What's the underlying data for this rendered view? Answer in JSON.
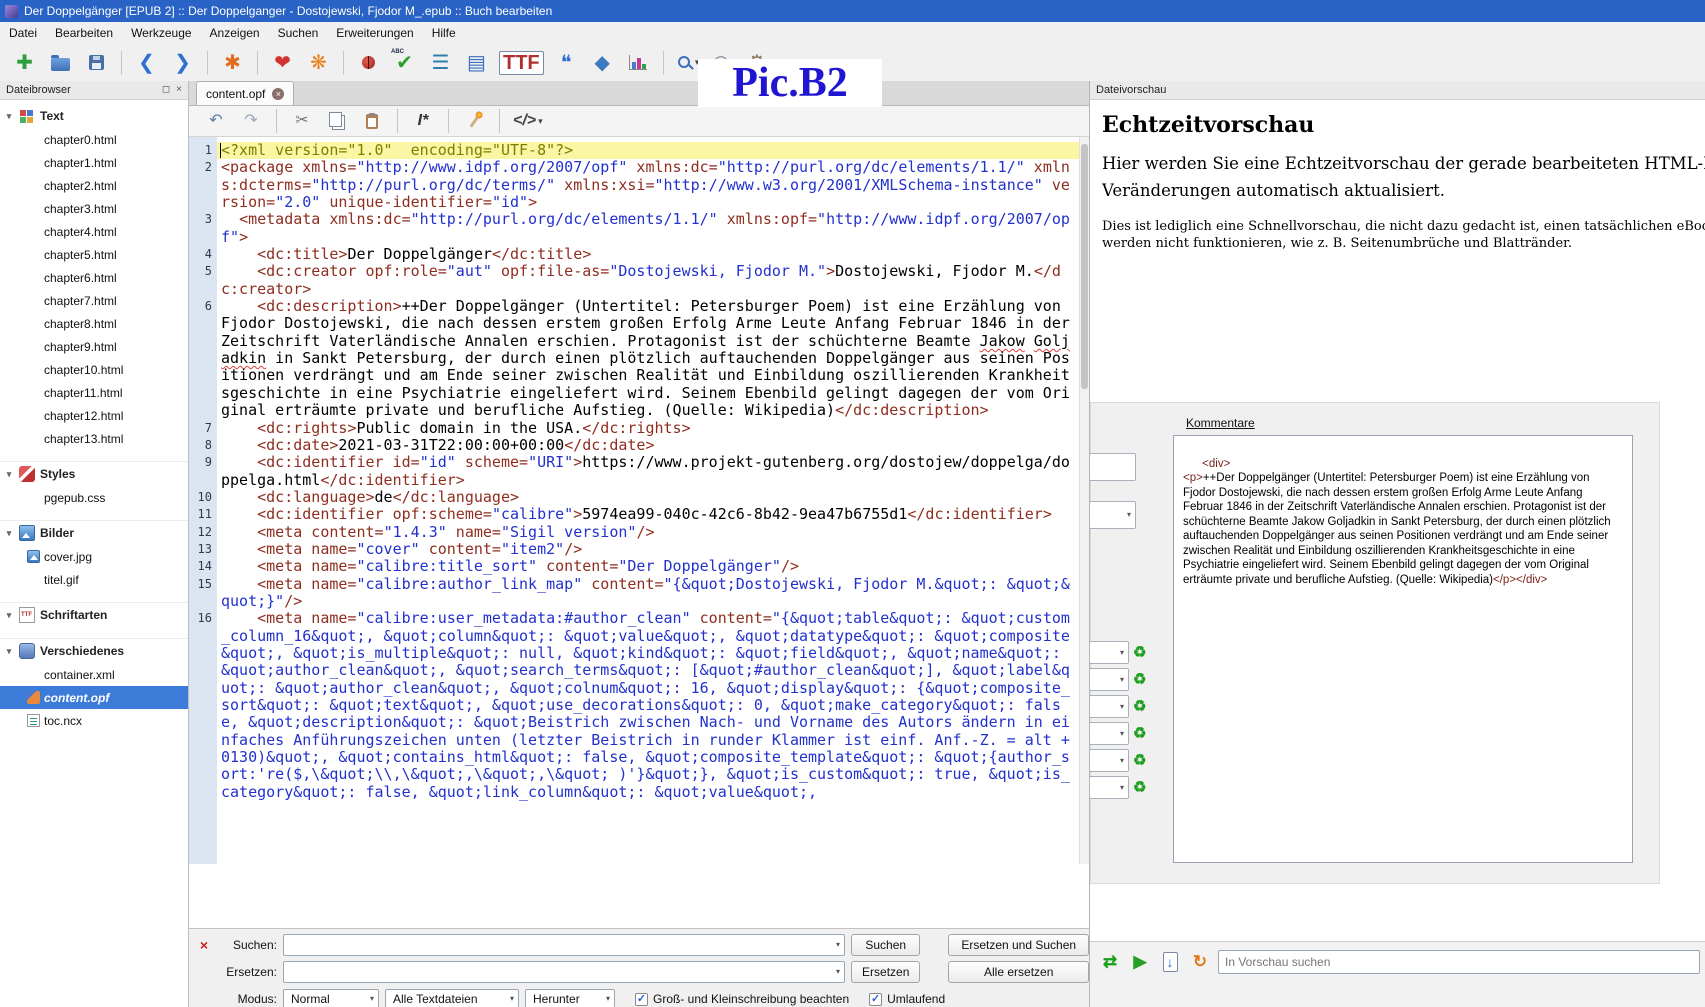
{
  "glyphs": {
    "collapse": "▾",
    "dropdown": "▾",
    "check": "✓",
    "close": "×",
    "float": "◻",
    "tab_close": "×"
  },
  "window": {
    "title": "Der Doppelgänger [EPUB 2] :: Der Doppelganger - Dostojewski, Fjodor M_.epub :: Buch bearbeiten"
  },
  "annotation": {
    "label": "Pic.B2"
  },
  "menu": {
    "items": [
      "Datei",
      "Bearbeiten",
      "Werkzeuge",
      "Anzeigen",
      "Suchen",
      "Erweiterungen",
      "Hilfe"
    ]
  },
  "toolbar": {
    "items": [
      {
        "name": "new-file-icon",
        "glyph": "✚",
        "color": "#2e9e3e"
      },
      {
        "name": "open-file-icon",
        "kind": "folder"
      },
      {
        "name": "save-icon",
        "kind": "floppy"
      },
      {
        "sep": true
      },
      {
        "name": "back-icon",
        "glyph": "❮",
        "color": "#2f6fd0"
      },
      {
        "name": "forward-icon",
        "glyph": "❯",
        "color": "#2f6fd0"
      },
      {
        "sep": true
      },
      {
        "name": "bookmark-icon",
        "glyph": "✱",
        "color": "#e06a1f"
      },
      {
        "sep": true
      },
      {
        "name": "donate-icon",
        "glyph": "❤",
        "color": "#d43333"
      },
      {
        "name": "plugin-manager-icon",
        "glyph": "❋",
        "color": "#e8821e"
      },
      {
        "sep": true
      },
      {
        "name": "wellformed-check-icon",
        "kind": "bug"
      },
      {
        "name": "spellcheck-icon",
        "glyph": "✔",
        "color": "#2f9e2f",
        "badge": "ABC"
      },
      {
        "name": "reformat-html-icon",
        "glyph": "☰",
        "color": "#2f7fae"
      },
      {
        "name": "index-editor-icon",
        "glyph": "▤",
        "color": "#3a6fc0"
      },
      {
        "name": "font-obfuscation-icon",
        "glyph": "TTF",
        "color": "#b03030",
        "boxed": true,
        "small": true
      },
      {
        "name": "quotes-icon",
        "glyph": "❝",
        "color": "#2f6fd0"
      },
      {
        "name": "clean-source-icon",
        "glyph": "◆",
        "color": "#3a7ac0"
      },
      {
        "name": "reports-icon",
        "kind": "chart"
      },
      {
        "sep": true
      },
      {
        "name": "special-tools-icon",
        "kind": "mag",
        "dd": true
      },
      {
        "name": "epubcheck-icon",
        "glyph": "◎",
        "color": "#7a8aa0",
        "dd": true
      },
      {
        "name": "plugins-icon",
        "glyph": "⚙",
        "color": "#8a7a60",
        "dd": true
      }
    ]
  },
  "filebrowser": {
    "title": "Dateibrowser",
    "sections": [
      {
        "label": "Text",
        "icon": "text-folder-icon",
        "children": [
          {
            "label": "chapter0.html"
          },
          {
            "label": "chapter1.html"
          },
          {
            "label": "chapter2.html"
          },
          {
            "label": "chapter3.html"
          },
          {
            "label": "chapter4.html"
          },
          {
            "label": "chapter5.html"
          },
          {
            "label": "chapter6.html"
          },
          {
            "label": "chapter7.html"
          },
          {
            "label": "chapter8.html"
          },
          {
            "label": "chapter9.html"
          },
          {
            "label": "chapter10.html"
          },
          {
            "label": "chapter11.html"
          },
          {
            "label": "chapter12.html"
          },
          {
            "label": "chapter13.html"
          }
        ]
      },
      {
        "label": "Styles",
        "icon": "styles-folder-icon",
        "children": [
          {
            "label": "pgepub.css"
          }
        ]
      },
      {
        "label": "Bilder",
        "icon": "images-folder-icon",
        "children": [
          {
            "label": "cover.jpg",
            "icon": "image-file-icon"
          },
          {
            "label": "titel.gif"
          }
        ]
      },
      {
        "label": "Schriftarten",
        "icon": "fonts-folder-icon",
        "children": []
      },
      {
        "label": "Verschiedenes",
        "icon": "misc-folder-icon",
        "children": [
          {
            "label": "container.xml"
          },
          {
            "label": "content.opf",
            "icon": "opf-file-icon",
            "selected": true
          },
          {
            "label": "toc.ncx",
            "icon": "ncx-file-icon"
          }
        ]
      }
    ]
  },
  "tab": {
    "label": "content.opf"
  },
  "editor_toolbar": {
    "items": [
      {
        "name": "undo-icon",
        "glyph": "↶",
        "color": "#5b7fa6"
      },
      {
        "name": "redo-icon",
        "glyph": "↷",
        "color": "#9aa8b8"
      },
      {
        "sep": true
      },
      {
        "name": "cut-icon",
        "glyph": "✂",
        "color": "#777777"
      },
      {
        "name": "copy-icon",
        "kind": "copy"
      },
      {
        "name": "paste-icon",
        "kind": "paste"
      },
      {
        "sep": true
      },
      {
        "name": "insert-special-icon",
        "glyph": "I*",
        "color": "#333333",
        "text": true
      },
      {
        "sep": true
      },
      {
        "name": "mend-icon",
        "kind": "match"
      },
      {
        "sep": true
      },
      {
        "name": "code-view-icon",
        "glyph": "</>",
        "color": "#444444",
        "text": true,
        "dd": true
      }
    ]
  },
  "editor": {
    "lines": [
      {
        "n": 1,
        "hl": true,
        "t": [
          [
            "pi",
            "<?xml version=\"1.0\"  encoding=\"UTF-8\"?>"
          ]
        ]
      },
      {
        "n": 2,
        "t": [
          [
            "tag",
            "<package xmlns="
          ],
          [
            "str",
            "\"http://www.idpf.org/2007/opf\""
          ],
          [
            "tag",
            " xmlns:dc="
          ],
          [
            "str",
            "\"http://purl.org/dc/elements/1.1/\""
          ],
          [
            "tag",
            " xmlns:dcterms="
          ],
          [
            "str",
            "\"http://purl.org/dc/terms/\""
          ],
          [
            "tag",
            " xmlns:xsi="
          ],
          [
            "str",
            "\"http://www.w3.org/2001/XMLSchema-instance\""
          ],
          [
            "tag",
            " version="
          ],
          [
            "str",
            "\"2.0\""
          ],
          [
            "tag",
            " unique-identifier="
          ],
          [
            "str",
            "\"id\""
          ],
          [
            "tag",
            ">"
          ]
        ]
      },
      {
        "n": 3,
        "t": [
          [
            "tag",
            "  <metadata xmlns:dc="
          ],
          [
            "str",
            "\"http://purl.org/dc/elements/1.1/\""
          ],
          [
            "tag",
            " xmlns:opf="
          ],
          [
            "str",
            "\"http://www.idpf.org/2007/opf\""
          ],
          [
            "tag",
            ">"
          ]
        ]
      },
      {
        "n": 4,
        "t": [
          [
            "tag",
            "    <dc:title>"
          ],
          [
            "txt",
            "Der Doppelgänger"
          ],
          [
            "tag",
            "</dc:title>"
          ]
        ]
      },
      {
        "n": 5,
        "t": [
          [
            "tag",
            "    <dc:creator opf:role="
          ],
          [
            "str",
            "\"aut\""
          ],
          [
            "tag",
            " opf:file-as="
          ],
          [
            "str",
            "\"Dostojewski, Fjodor M.\""
          ],
          [
            "tag",
            ">"
          ],
          [
            "txt",
            "Dostojewski, Fjodor M."
          ],
          [
            "tag",
            "</dc:creator>"
          ]
        ]
      },
      {
        "n": 6,
        "t": [
          [
            "tag",
            "    <dc:description>"
          ],
          [
            "txt",
            "++Der Doppelgänger (Untertitel: Petersburger Poem) ist eine Erzählung von Fjodor Dostojewski, die nach dessen erstem großen Erfolg Arme Leute Anfang Februar 1846 in der Zeitschrift Vaterländische Annalen erschien. Protagonist ist der schüchterne Beamte "
          ],
          [
            "mis",
            "Jakow"
          ],
          [
            "txt",
            " "
          ],
          [
            "mis",
            "Goljadkin"
          ],
          [
            "txt",
            " in Sankt Petersburg, der durch einen plötzlich auftauchenden Doppelgänger aus seinen Positionen verdrängt und am Ende seiner zwischen Realität und Einbildung oszillierenden Krankheitsgeschichte in eine Psychiatrie eingeliefert wird. Seinem Ebenbild gelingt dagegen der vom Original erträumte private und berufliche Aufstieg. (Quelle: Wikipedia)"
          ],
          [
            "tag",
            "</dc:description>"
          ]
        ]
      },
      {
        "n": 7,
        "t": [
          [
            "tag",
            "    <dc:rights>"
          ],
          [
            "txt",
            "Public domain in the USA."
          ],
          [
            "tag",
            "</dc:rights>"
          ]
        ]
      },
      {
        "n": 8,
        "t": [
          [
            "tag",
            "    <dc:date>"
          ],
          [
            "txt",
            "2021-03-31T22:00:00+00:00"
          ],
          [
            "tag",
            "</dc:date>"
          ]
        ]
      },
      {
        "n": 9,
        "t": [
          [
            "tag",
            "    <dc:identifier id="
          ],
          [
            "str",
            "\"id\""
          ],
          [
            "tag",
            " scheme="
          ],
          [
            "str",
            "\"URI\""
          ],
          [
            "tag",
            ">"
          ],
          [
            "txt",
            "https://www.projekt-gutenberg.org/dostojew/doppelga/doppelga.html"
          ],
          [
            "tag",
            "</dc:identifier>"
          ]
        ]
      },
      {
        "n": 10,
        "t": [
          [
            "tag",
            "    <dc:language>"
          ],
          [
            "txt",
            "de"
          ],
          [
            "tag",
            "</dc:language>"
          ]
        ]
      },
      {
        "n": 11,
        "t": [
          [
            "tag",
            "    <dc:identifier opf:scheme="
          ],
          [
            "str",
            "\"calibre\""
          ],
          [
            "tag",
            ">"
          ],
          [
            "txt",
            "5974ea99-040c-42c6-8b42-9ea47b6755d1"
          ],
          [
            "tag",
            "</dc:identifier>"
          ]
        ]
      },
      {
        "n": 12,
        "t": [
          [
            "tag",
            "    <meta content="
          ],
          [
            "str",
            "\"1.4.3\""
          ],
          [
            "tag",
            " name="
          ],
          [
            "str",
            "\"Sigil version\""
          ],
          [
            "tag",
            "/>"
          ]
        ]
      },
      {
        "n": 13,
        "t": [
          [
            "tag",
            "    <meta name="
          ],
          [
            "str",
            "\"cover\""
          ],
          [
            "tag",
            " content="
          ],
          [
            "str",
            "\"item2\""
          ],
          [
            "tag",
            "/>"
          ]
        ]
      },
      {
        "n": 14,
        "t": [
          [
            "tag",
            "    <meta name="
          ],
          [
            "str",
            "\"calibre:title_sort\""
          ],
          [
            "tag",
            " content="
          ],
          [
            "str",
            "\"Der Doppelgänger\""
          ],
          [
            "tag",
            "/>"
          ]
        ]
      },
      {
        "n": 15,
        "t": [
          [
            "tag",
            "    <meta name="
          ],
          [
            "str",
            "\"calibre:author_link_map\""
          ],
          [
            "tag",
            " content="
          ],
          [
            "str",
            "\"{&quot;Dostojewski, Fjodor M.&quot;: &quot;&quot;}\""
          ],
          [
            "tag",
            "/>"
          ]
        ]
      },
      {
        "n": 16,
        "t": [
          [
            "tag",
            "    <meta name="
          ],
          [
            "str",
            "\"calibre:user_metadata:#author_clean\""
          ],
          [
            "tag",
            " content="
          ],
          [
            "str",
            "\"{&quot;table&quot;: &quot;custom_column_16&quot;, &quot;column&quot;: &quot;value&quot;, &quot;datatype&quot;: &quot;composite&quot;, &quot;is_multiple&quot;: null, &quot;kind&quot;: &quot;field&quot;, &quot;name&quot;: &quot;author_clean&quot;, &quot;search_terms&quot;: [&quot;#author_clean&quot;], &quot;label&quot;: &quot;author_clean&quot;, &quot;colnum&quot;: 16, &quot;display&quot;: {&quot;composite_sort&quot;: &quot;text&quot;, &quot;use_decorations&quot;: 0, &quot;make_category&quot;: false, &quot;description&quot;: &quot;Beistrich zwischen Nach- und Vorname des Autors ändern in einfaches Anführungszeichen unten (letzter Beistrich in runder Klammer ist einf. Anf.-Z. = alt + 0130)&quot;, &quot;contains_html&quot;: false, &quot;composite_template&quot;: &quot;{author_sort:'re($,\\&quot;\\\\,\\&quot;,\\&quot;,\\&quot; )'}&quot;}, &quot;is_custom&quot;: true, &quot;is_category&quot;: false, &quot;link_column&quot;: &quot;value&quot;,"
          ]
        ]
      }
    ]
  },
  "search": {
    "suchen_label": "Suchen:",
    "ersetzen_label": "Ersetzen:",
    "modus_label": "Modus:",
    "btn_suchen": "Suchen",
    "btn_ersetzen_und_suchen": "Ersetzen und Suchen",
    "btn_ersetzen": "Ersetzen",
    "btn_alle_ersetzen": "Alle ersetzen",
    "modus_value": "Normal",
    "dateien_value": "Alle Textdateien",
    "richtung_value": "Herunter",
    "check1": "Groß- und Kleinschreibung beachten",
    "check2": "Umlaufend"
  },
  "preview": {
    "title": "Dateivorschau",
    "heading": "Echtzeitvorschau",
    "p1_lines": [
      "Hier werden Sie eine Echtzeitvorschau der gerade bearbeiteten HTML-Datei sehen. Die",
      "Veränderungen automatisch aktualisiert."
    ],
    "p2_lines": [
      "Dies ist lediglich eine Schnellvorschau, die nicht dazu gedacht ist, einen tatsächlichen eBook-Reader zu simulieren.",
      "werden nicht funktionieren, wie z. B. Seitenumbrüche und Blattränder."
    ],
    "search_placeholder": "In Vorschau suchen",
    "buttons": [
      {
        "name": "refresh-preview-icon",
        "glyph": "⇄",
        "color": "#17a017"
      },
      {
        "name": "run-preview-icon",
        "glyph": "▶",
        "color": "#28a028"
      },
      {
        "name": "save-preview-icon",
        "glyph": "↓",
        "color": "#2a6fd0",
        "boxed": true
      },
      {
        "name": "reload-preview-icon",
        "glyph": "↻",
        "color": "#e07a1a"
      }
    ]
  },
  "metadata_dialog": {
    "kommentare_label": "Kommentare",
    "swap_glyph": "♻",
    "swap_color": "#1e9e1e",
    "swap_count": 6,
    "comment_tokens": [
      [
        "tag",
        "<div>\n<p>"
      ],
      [
        "txt",
        "++Der Doppelgänger (Untertitel: Petersburger Poem) ist eine Erzählung von Fjodor Dostojewski, die nach dessen erstem großen Erfolg Arme Leute Anfang Februar 1846 in der Zeitschrift Vaterländische Annalen erschien. Protagonist ist der schüchterne Beamte Jakow Goljadkin in Sankt Petersburg, der durch einen plötzlich auftauchenden Doppelgänger aus seinen Positionen verdrängt und am Ende seiner zwischen Realität und Einbildung oszillierenden Krankheitsgeschichte in eine Psychiatrie eingeliefert wird. Seinem Ebenbild gelingt dagegen der vom Original erträumte private und berufliche Aufstieg. (Quelle: Wikipedia)"
      ],
      [
        "tag",
        "</p></div>"
      ]
    ]
  }
}
